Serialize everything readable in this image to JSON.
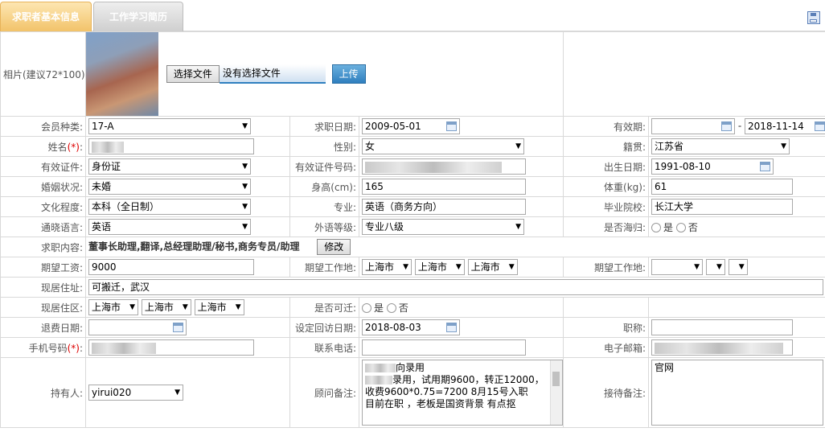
{
  "tabs": {
    "basic": "求职者基本信息",
    "resume": "工作学习简历"
  },
  "photo": {
    "label": "相片(建议72*100):",
    "choose_button": "选择文件",
    "no_file": "没有选择文件",
    "upload_button": "上传"
  },
  "fields": {
    "member_type": {
      "label": "会员种类:",
      "value": "17-A"
    },
    "apply_date": {
      "label": "求职日期:",
      "value": "2009-05-01"
    },
    "valid_period": {
      "label": "有效期:",
      "start": "",
      "sep": "-",
      "end": "2018-11-14"
    },
    "name": {
      "label": "姓名",
      "req": "(*)",
      "colon": ":"
    },
    "gender": {
      "label": "性别:",
      "value": "女"
    },
    "hometown": {
      "label": "籍贯:",
      "value": "江苏省"
    },
    "id_type": {
      "label": "有效证件:",
      "value": "身份证"
    },
    "id_number": {
      "label": "有效证件号码:"
    },
    "birth_date": {
      "label": "出生日期:",
      "value": "1991-08-10"
    },
    "marital": {
      "label": "婚姻状况:",
      "value": "未婚"
    },
    "height": {
      "label": "身高(cm):",
      "value": "165"
    },
    "weight": {
      "label": "体重(kg):",
      "value": "61"
    },
    "education": {
      "label": "文化程度:",
      "value": "本科（全日制）"
    },
    "major": {
      "label": "专业:",
      "value": "英语（商务方向）"
    },
    "school": {
      "label": "毕业院校:",
      "value": "长江大学"
    },
    "language": {
      "label": "通晓语言:",
      "value": "英语"
    },
    "lang_level": {
      "label": "外语等级:",
      "value": "专业八级"
    },
    "overseas": {
      "label": "是否海归:",
      "yes": "是",
      "no": "否"
    },
    "job_content": {
      "label": "求职内容:",
      "value": "董事长助理,翻译,总经理助理/秘书,商务专员/助理",
      "modify_button": "修改"
    },
    "salary": {
      "label": "期望工资:",
      "value": "9000"
    },
    "work_place1": {
      "label": "期望工作地:",
      "v1": "上海市",
      "v2": "上海市",
      "v3": "上海市"
    },
    "work_place2": {
      "label": "期望工作地:"
    },
    "address": {
      "label": "现居住址:",
      "value": "可搬迁，武汉"
    },
    "residence": {
      "label": "现居住区:",
      "v1": "上海市",
      "v2": "上海市",
      "v3": "上海市"
    },
    "relocate": {
      "label": "是否可迁:",
      "yes": "是",
      "no": "否"
    },
    "refund_date": {
      "label": "退费日期:",
      "value": ""
    },
    "visit_date": {
      "label": "设定回访日期:",
      "value": "2018-08-03"
    },
    "title": {
      "label": "职称:",
      "value": ""
    },
    "mobile": {
      "label": "手机号码",
      "req": "(*)",
      "colon": ":"
    },
    "phone": {
      "label": "联系电话:",
      "value": ""
    },
    "email": {
      "label": "电子邮箱:"
    },
    "holder": {
      "label": "持有人:",
      "value": "yirui020"
    },
    "consultant_note": {
      "label": "顾问备注:",
      "line1": "向录用",
      "line2": "录用，试用期9600，转正12000，收费9600*0.75=7200 8月15号入职",
      "line3": "目前在职 ，老板是国资背景 有点抠"
    },
    "reception_note": {
      "label": "接待备注:",
      "value": "官网"
    }
  },
  "colors": {
    "tab_active": "#f2c36a",
    "tab_inactive": "#cfcfcf",
    "upload": "#2f7fbf",
    "required": "#dd0000"
  },
  "icons": {
    "save": "save-icon",
    "calendar": "calendar-icon"
  }
}
